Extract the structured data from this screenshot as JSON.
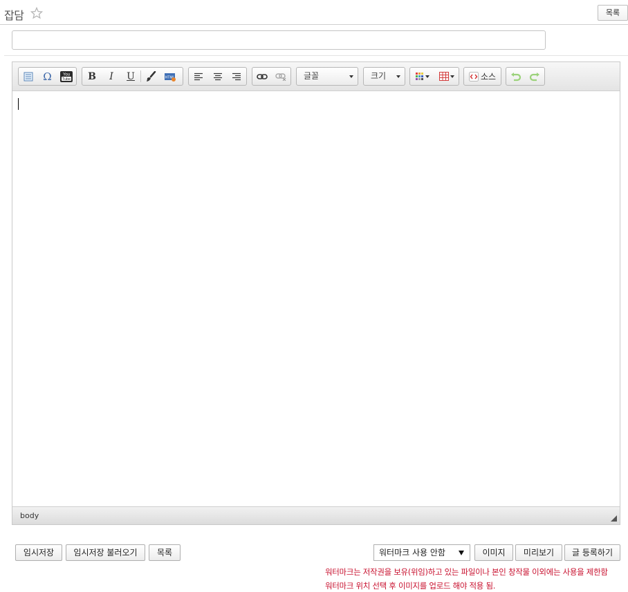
{
  "header": {
    "title": "잡담",
    "list_button": "목록"
  },
  "subject": {
    "value": "",
    "placeholder": ""
  },
  "toolbar": {
    "groups": [
      [
        "document-icon",
        "omega-icon",
        "youtube-icon"
      ],
      [
        "bold-icon",
        "italic-icon",
        "underline-icon",
        "brush-icon",
        "html-icon"
      ],
      [
        "align-left-icon",
        "align-center-icon",
        "align-right-icon"
      ],
      [
        "link-icon",
        "unlink-icon"
      ]
    ],
    "font_label": "글꼴",
    "size_label": "크기",
    "source_label": "소스",
    "youtube_text": "You Tube"
  },
  "status": {
    "path": "body"
  },
  "actions": {
    "temp_save": "임시저장",
    "temp_load": "임시저장 불러오기",
    "list": "목록",
    "watermark_selected": "워터마크 사용 안함",
    "image": "이미지",
    "preview": "미리보기",
    "submit": "글 등록하기"
  },
  "notices": [
    "워터마크는 저작권을 보유(위임)하고 있는 파일이나 본인 창작물 이외에는 사용을 제한함",
    "워터마크 위치 선택 후 이미지를 업로드 해야 적용 됨."
  ],
  "colors": {
    "notice": "#c8102e",
    "toolbar_bg": "#e8e8e8",
    "border": "#c9c9c9"
  }
}
